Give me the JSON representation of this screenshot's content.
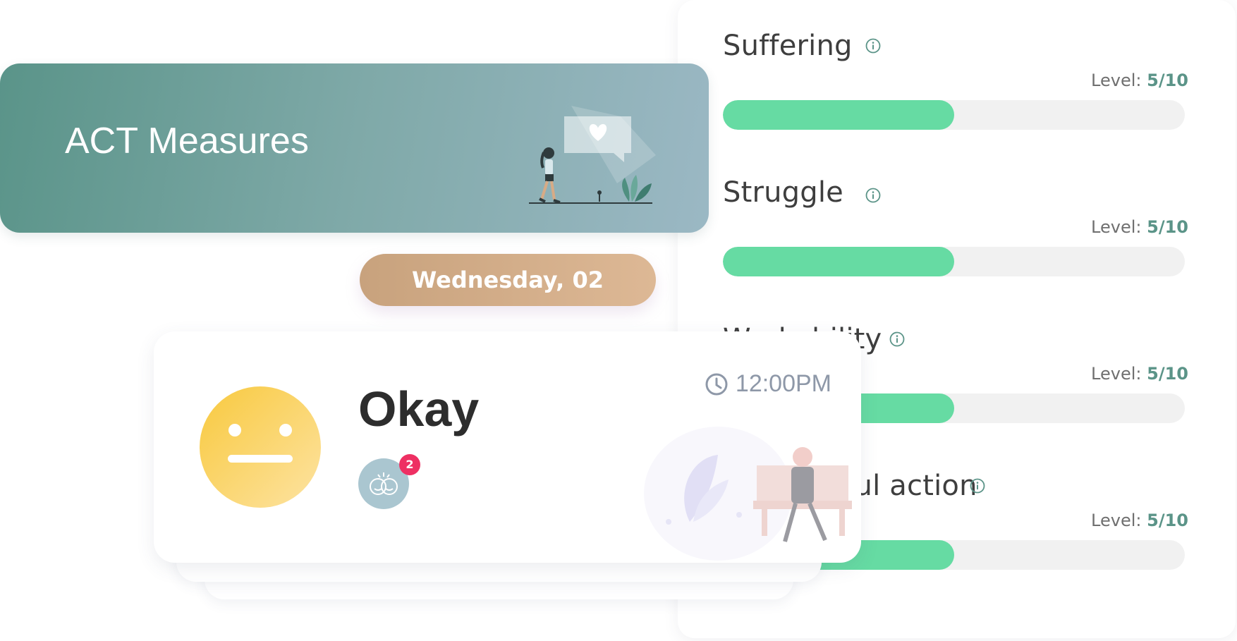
{
  "measures": {
    "items": [
      {
        "title": "Suffering",
        "level_label": "Level:",
        "level_value": "5/10",
        "level": 5,
        "max": 10
      },
      {
        "title": "Struggle",
        "level_label": "Level:",
        "level_value": "5/10",
        "level": 5,
        "max": 10
      },
      {
        "title": "Workability",
        "level_label": "Level:",
        "level_value": "5/10",
        "level": 5,
        "max": 10
      },
      {
        "title": "Meaningful action",
        "level_label": "Level:",
        "level_value": "5/10",
        "level": 5,
        "max": 10
      }
    ],
    "info_icon": "info-icon"
  },
  "banner": {
    "title": "ACT Measures",
    "illustration": "walking-woman-heart-illustration"
  },
  "date_pill": {
    "label": "Wednesday, 02"
  },
  "entry": {
    "mood": "Okay",
    "mood_icon": "neutral-face-icon",
    "time": "12:00PM",
    "time_icon": "clock-icon",
    "activity_icon": "friends-icon",
    "activity_count": "2"
  },
  "colors": {
    "bar_fill": "#66dba3",
    "bar_track": "#f1f1f1",
    "level_value": "#5b9488",
    "banner_start": "#5a9489",
    "banner_end": "#9bb8c4",
    "pill": "#d2ad89",
    "badge": "#ee3063",
    "face": "#f9cc46"
  }
}
